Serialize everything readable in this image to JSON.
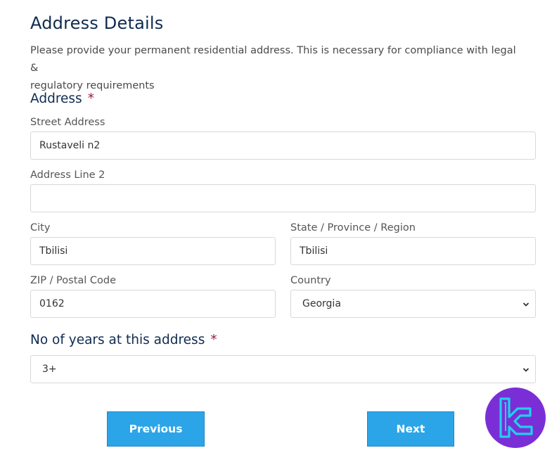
{
  "header": {
    "title": "Address Details",
    "intro_line1": "Please provide your permanent residential address. This is necessary for compliance with legal &",
    "intro_line2": "regulatory requirements"
  },
  "address": {
    "section_label": "Address",
    "required_mark": "*",
    "street": {
      "label": "Street Address",
      "value": "Rustaveli n2"
    },
    "line2": {
      "label": "Address Line 2",
      "value": ""
    },
    "city": {
      "label": "City",
      "value": "Tbilisi"
    },
    "state": {
      "label": "State / Province / Region",
      "value": "Tbilisi"
    },
    "zip": {
      "label": "ZIP / Postal Code",
      "value": "0162"
    },
    "country": {
      "label": "Country",
      "value": "Georgia"
    }
  },
  "years": {
    "section_label": "No of years at this address",
    "required_mark": "*",
    "value": "3+"
  },
  "buttons": {
    "previous": "Previous",
    "next": "Next"
  },
  "colors": {
    "heading": "#0f2b50",
    "required": "#9b1c3c",
    "button": "#2ba5e8",
    "logo_bg": "#7a2fd6"
  }
}
